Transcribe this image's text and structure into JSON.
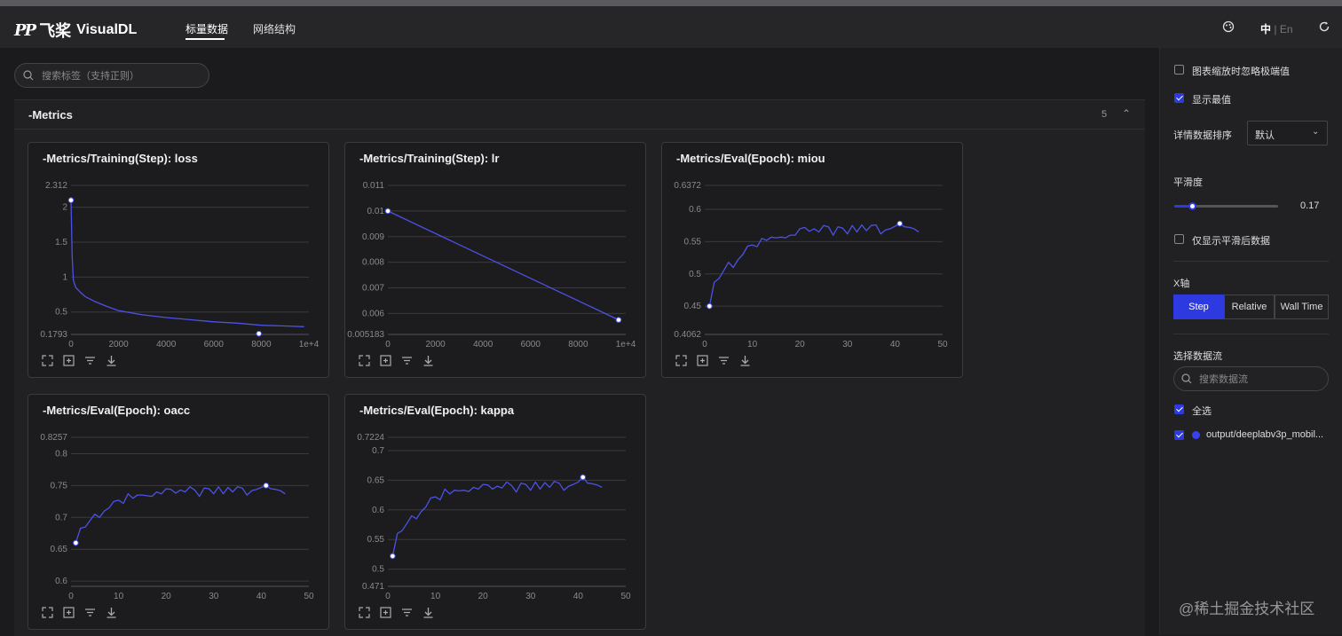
{
  "app": {
    "brand_mark": "PP",
    "brand_cn": "飞桨",
    "brand_name": "VisualDL",
    "nav_tabs": [
      {
        "label": "标量数据",
        "active": true
      },
      {
        "label": "网络结构",
        "active": false
      }
    ],
    "lang": {
      "active": "中",
      "separator": "|",
      "other": "En"
    },
    "accent_color": "#2d3ae0",
    "line_color": "#4b52e6"
  },
  "search": {
    "placeholder": "搜索标签（支持正则）"
  },
  "group": {
    "title": "-Metrics",
    "count": "5"
  },
  "charts": [
    {
      "title": "-Metrics/Training(Step): loss"
    },
    {
      "title": "-Metrics/Training(Step): lr"
    },
    {
      "title": "-Metrics/Eval(Epoch): miou"
    },
    {
      "title": "-Metrics/Eval(Epoch): oacc"
    },
    {
      "title": "-Metrics/Eval(Epoch): kappa"
    }
  ],
  "chart_data": [
    {
      "type": "line",
      "title": "-Metrics/Training(Step): loss",
      "xlim": [
        0,
        10000
      ],
      "ylim": [
        0.1793,
        2.312
      ],
      "x_ticks": [
        "0",
        "2000",
        "4000",
        "6000",
        "8000",
        "1e+4"
      ],
      "y_ticks": [
        "2.312",
        "2",
        "1.5",
        "1",
        "0.5",
        "0.1793"
      ],
      "series": [
        {
          "x": [
            0,
            50,
            100,
            200,
            400,
            600,
            1000,
            1500,
            2000,
            3000,
            4000,
            5000,
            6000,
            7000,
            8000,
            9000,
            9800
          ],
          "y": [
            2.1,
            1.3,
            0.95,
            0.85,
            0.78,
            0.72,
            0.65,
            0.58,
            0.52,
            0.46,
            0.42,
            0.39,
            0.36,
            0.34,
            0.31,
            0.3,
            0.29
          ]
        }
      ],
      "markers": [
        {
          "x": 0,
          "y": 2.1
        },
        {
          "x": 7900,
          "y": 0.19
        }
      ]
    },
    {
      "type": "line",
      "title": "-Metrics/Training(Step): lr",
      "xlim": [
        0,
        10000
      ],
      "ylim": [
        0.005183,
        0.011
      ],
      "x_ticks": [
        "0",
        "2000",
        "4000",
        "6000",
        "8000",
        "1e+4"
      ],
      "y_ticks": [
        "0.011",
        "0.01",
        "0.009",
        "0.008",
        "0.007",
        "0.006",
        "0.005183"
      ],
      "series": [
        {
          "x": [
            0,
            9700
          ],
          "y": [
            0.01,
            0.00575
          ]
        }
      ],
      "markers": [
        {
          "x": 0,
          "y": 0.01
        },
        {
          "x": 9700,
          "y": 0.00575
        }
      ]
    },
    {
      "type": "line",
      "title": "-Metrics/Eval(Epoch): miou",
      "xlim": [
        0,
        50
      ],
      "ylim": [
        0.4062,
        0.6372
      ],
      "x_ticks": [
        "0",
        "10",
        "20",
        "30",
        "40",
        "50"
      ],
      "y_ticks": [
        "0.6372",
        "0.6",
        "0.55",
        "0.5",
        "0.45",
        "0.4062"
      ],
      "series": [
        {
          "x": [
            1,
            2,
            3,
            4,
            5,
            6,
            7,
            8,
            9,
            10,
            11,
            12,
            13,
            14,
            15,
            16,
            17,
            18,
            19,
            20,
            21,
            22,
            23,
            24,
            25,
            26,
            27,
            28,
            29,
            30,
            31,
            32,
            33,
            34,
            35,
            36,
            37,
            38,
            39,
            40,
            41,
            42,
            43,
            44,
            45
          ],
          "y": [
            0.45,
            0.487,
            0.493,
            0.505,
            0.518,
            0.51,
            0.522,
            0.53,
            0.543,
            0.545,
            0.542,
            0.555,
            0.552,
            0.557,
            0.556,
            0.557,
            0.556,
            0.56,
            0.56,
            0.57,
            0.572,
            0.566,
            0.57,
            0.565,
            0.575,
            0.573,
            0.56,
            0.573,
            0.571,
            0.562,
            0.575,
            0.565,
            0.576,
            0.567,
            0.575,
            0.576,
            0.562,
            0.568,
            0.57,
            0.574,
            0.578,
            0.573,
            0.572,
            0.57,
            0.565
          ]
        }
      ],
      "markers": [
        {
          "x": 1,
          "y": 0.45
        },
        {
          "x": 41,
          "y": 0.578
        }
      ]
    },
    {
      "type": "line",
      "title": "-Metrics/Eval(Epoch): oacc",
      "xlim": [
        0,
        50
      ],
      "ylim": [
        0.5918,
        0.8257
      ],
      "x_ticks": [
        "0",
        "10",
        "20",
        "30",
        "40",
        "50"
      ],
      "y_ticks": [
        "0.8257",
        "0.8",
        "0.75",
        "0.7",
        "0.65",
        "0.6"
      ],
      "series": [
        {
          "x": [
            1,
            2,
            3,
            4,
            5,
            6,
            7,
            8,
            9,
            10,
            11,
            12,
            13,
            14,
            15,
            16,
            17,
            18,
            19,
            20,
            21,
            22,
            23,
            24,
            25,
            26,
            27,
            28,
            29,
            30,
            31,
            32,
            33,
            34,
            35,
            36,
            37,
            38,
            39,
            40,
            41,
            42,
            43,
            44,
            45
          ],
          "y": [
            0.66,
            0.683,
            0.685,
            0.695,
            0.705,
            0.7,
            0.71,
            0.715,
            0.725,
            0.727,
            0.722,
            0.737,
            0.73,
            0.735,
            0.735,
            0.734,
            0.733,
            0.74,
            0.737,
            0.745,
            0.744,
            0.738,
            0.743,
            0.74,
            0.748,
            0.743,
            0.733,
            0.746,
            0.745,
            0.737,
            0.748,
            0.737,
            0.747,
            0.74,
            0.748,
            0.746,
            0.735,
            0.742,
            0.744,
            0.747,
            0.75,
            0.745,
            0.744,
            0.742,
            0.737
          ]
        }
      ],
      "markers": [
        {
          "x": 1,
          "y": 0.66
        },
        {
          "x": 41,
          "y": 0.75
        }
      ]
    },
    {
      "type": "line",
      "title": "-Metrics/Eval(Epoch): kappa",
      "xlim": [
        0,
        50
      ],
      "ylim": [
        0.471,
        0.7224
      ],
      "x_ticks": [
        "0",
        "10",
        "20",
        "30",
        "40",
        "50"
      ],
      "y_ticks": [
        "0.7224",
        "0.7",
        "0.65",
        "0.6",
        "0.55",
        "0.5",
        "0.471"
      ],
      "series": [
        {
          "x": [
            1,
            2,
            3,
            4,
            5,
            6,
            7,
            8,
            9,
            10,
            11,
            12,
            13,
            14,
            15,
            16,
            17,
            18,
            19,
            20,
            21,
            22,
            23,
            24,
            25,
            26,
            27,
            28,
            29,
            30,
            31,
            32,
            33,
            34,
            35,
            36,
            37,
            38,
            39,
            40,
            41,
            42,
            43,
            44,
            45
          ],
          "y": [
            0.522,
            0.56,
            0.565,
            0.577,
            0.59,
            0.585,
            0.597,
            0.605,
            0.62,
            0.622,
            0.617,
            0.635,
            0.627,
            0.633,
            0.632,
            0.633,
            0.631,
            0.638,
            0.635,
            0.643,
            0.642,
            0.635,
            0.64,
            0.637,
            0.647,
            0.641,
            0.63,
            0.645,
            0.643,
            0.633,
            0.647,
            0.635,
            0.646,
            0.638,
            0.648,
            0.645,
            0.633,
            0.64,
            0.643,
            0.647,
            0.655,
            0.645,
            0.644,
            0.642,
            0.638
          ]
        }
      ],
      "markers": [
        {
          "x": 1,
          "y": 0.522
        },
        {
          "x": 41,
          "y": 0.655
        }
      ]
    }
  ],
  "sidebar": {
    "ignore_outliers": {
      "label": "图表缩放时忽略极端值",
      "checked": false
    },
    "show_extremes": {
      "label": "显示最值",
      "checked": true
    },
    "sort_label": "详情数据排序",
    "sort_value": "默认",
    "smoothing_label": "平滑度",
    "smoothing_value": "0.17",
    "smoothing_fraction": 0.17,
    "only_smoothed": {
      "label": "仅显示平滑后数据",
      "checked": false
    },
    "xaxis_label": "X轴",
    "xaxis_options": [
      "Step",
      "Relative",
      "Wall Time"
    ],
    "xaxis_active": "Step",
    "runs_label": "选择数据流",
    "runs_search_placeholder": "搜索数据流",
    "select_all": {
      "label": "全选",
      "checked": true
    },
    "runs": [
      {
        "label": "output/deeplabv3p_mobil...",
        "checked": true,
        "color": "#3a3ff0"
      }
    ]
  },
  "watermark": "@稀土掘金技术社区"
}
